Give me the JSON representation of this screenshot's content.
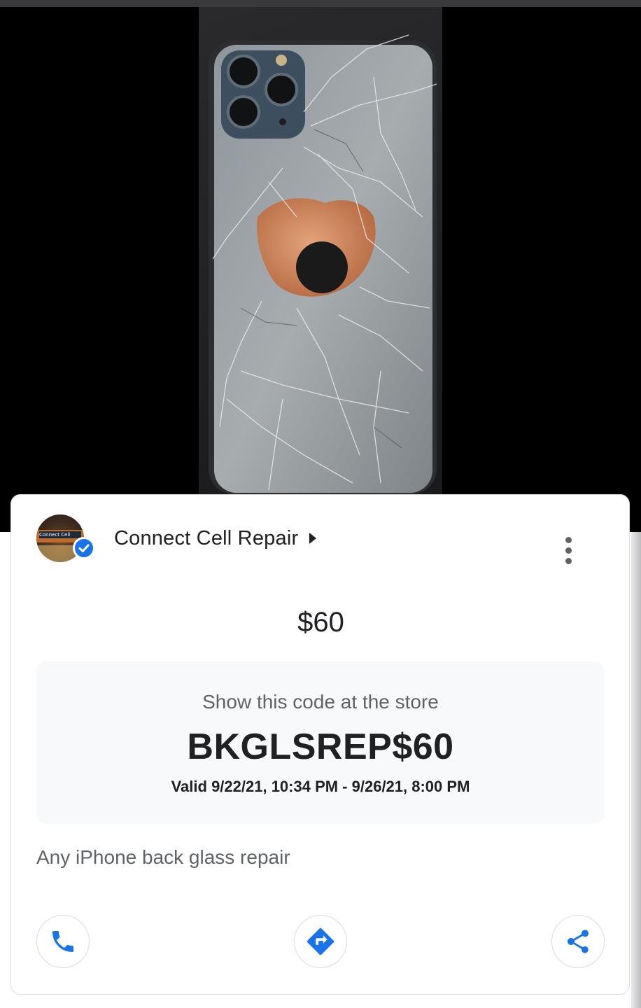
{
  "business": {
    "name": "Connect Cell Repair",
    "avatar_sign_text": "Connect Cell",
    "verified": true
  },
  "offer": {
    "price": "$60",
    "code_instruction": "Show this code at the store",
    "code": "BKGLSREP$60",
    "validity": "Valid 9/22/21, 10:34 PM - 9/26/21, 8:00 PM",
    "description": "Any iPhone back glass repair"
  },
  "actions": [
    {
      "icon": "phone-icon"
    },
    {
      "icon": "directions-icon"
    },
    {
      "icon": "share-icon"
    }
  ],
  "colors": {
    "accent": "#1a73e8",
    "primary_text": "#202124",
    "secondary_text": "#5f6368",
    "card_border": "#dadce0",
    "code_box_bg": "#f8f9fa"
  }
}
